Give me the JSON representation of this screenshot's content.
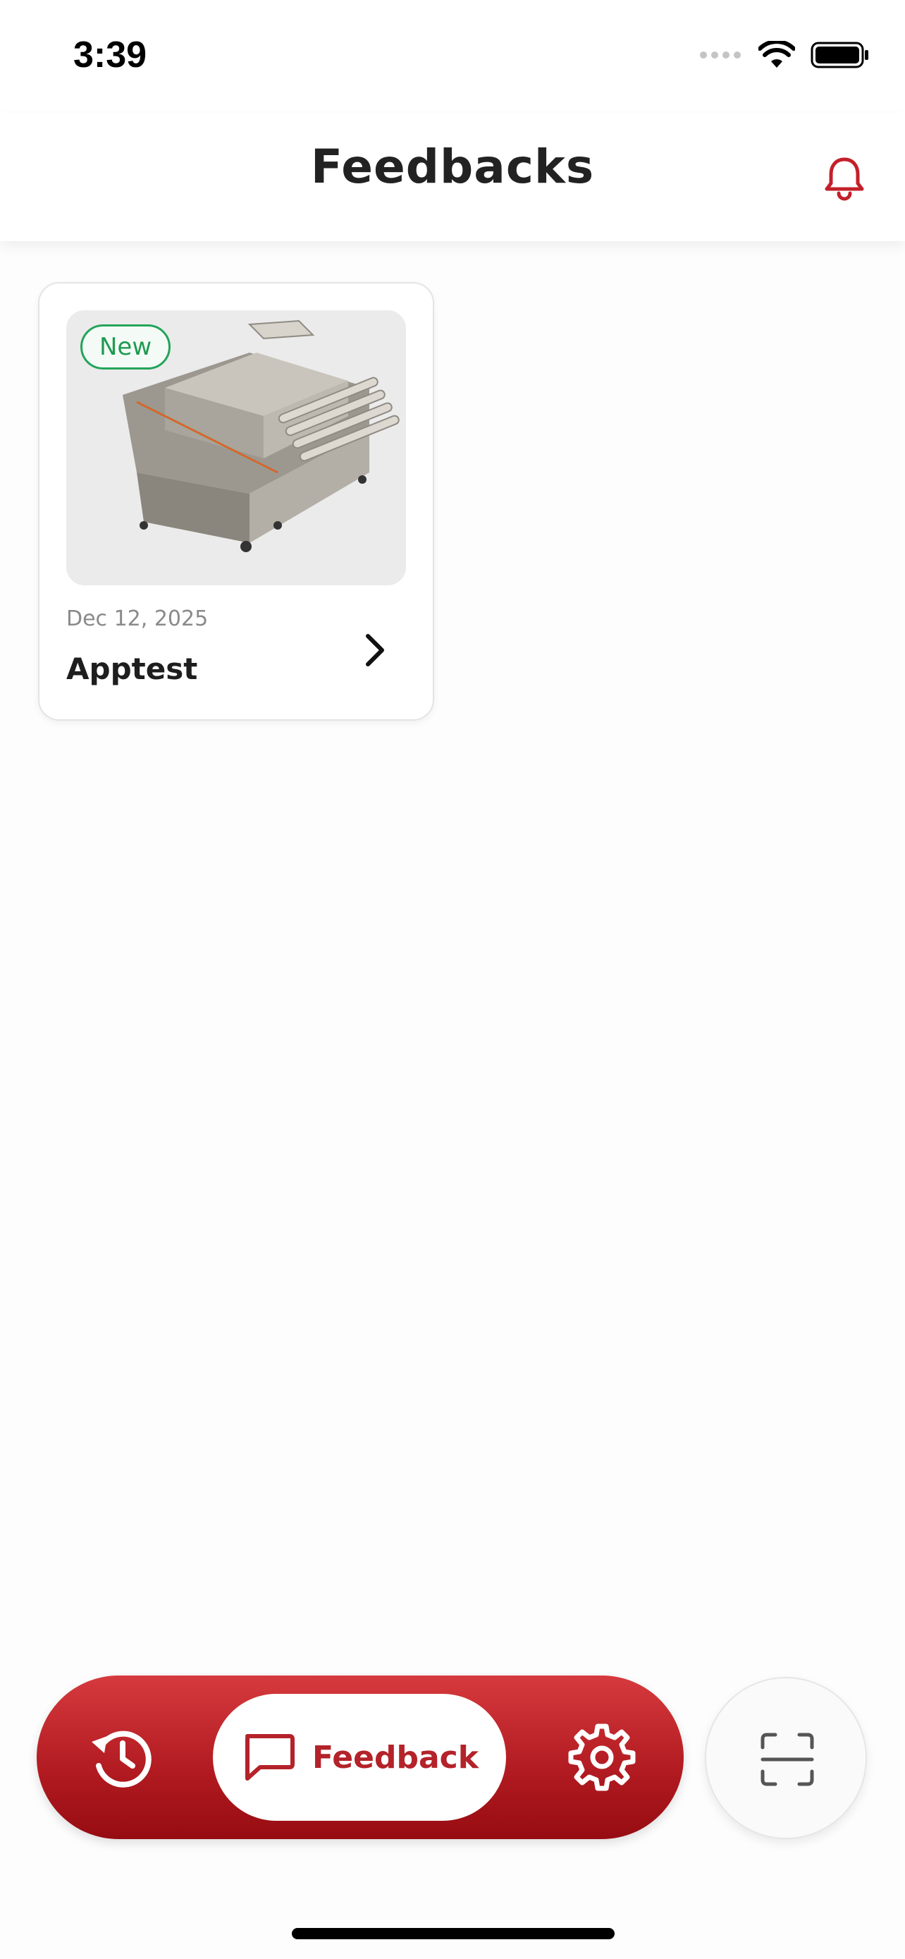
{
  "status_bar": {
    "time": "3:39"
  },
  "header": {
    "title": "Feedbacks",
    "bell_icon": "bell-icon"
  },
  "feedbacks": [
    {
      "badge": "New",
      "date": "Dec 12, 2025",
      "title": "Apptest",
      "image": "industrial-machine-photo"
    }
  ],
  "bottom_nav": {
    "items": [
      {
        "icon": "history-icon"
      },
      {
        "icon": "chat-icon",
        "label": "Feedback",
        "active": true
      },
      {
        "icon": "gear-icon"
      }
    ],
    "scan_icon": "scan-icon"
  },
  "colors": {
    "accent": "#b01a20",
    "badge_green": "#23a45a",
    "background": "#fdfdfd"
  }
}
